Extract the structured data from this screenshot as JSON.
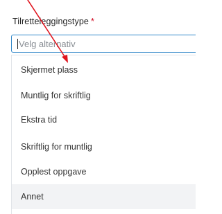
{
  "field": {
    "label": "Tilretteleggingstype",
    "required_mark": "*",
    "placeholder": "Velg alternativ"
  },
  "dropdown": {
    "options": [
      "Skjermet plass",
      "Muntlig for skriftlig",
      "Ekstra tid",
      "Skriftlig for muntlig",
      "Opplest oppgave",
      "Annet"
    ]
  },
  "colors": {
    "focus_border": "#2f86c8",
    "required": "#d0021b",
    "hover_bg": "#f2f3f5",
    "annotation_arrow": "#e0141e"
  }
}
